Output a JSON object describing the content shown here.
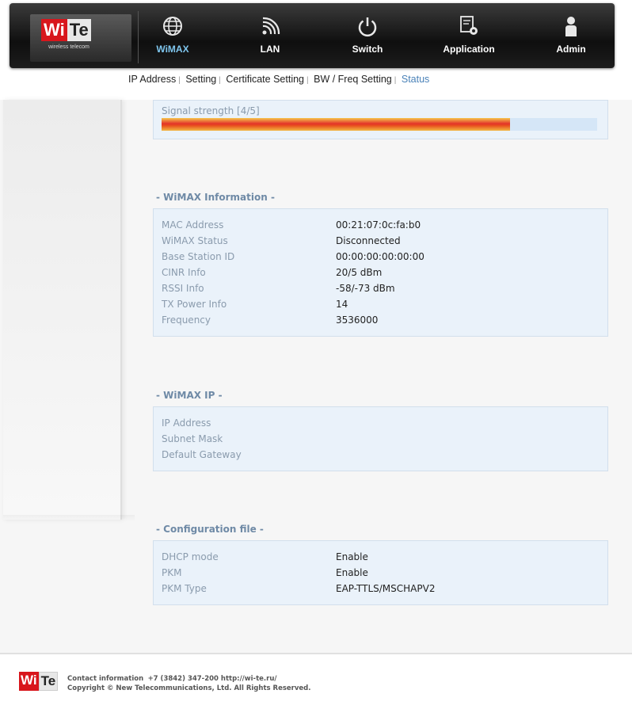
{
  "brand": {
    "logo_wi": "Wi",
    "logo_te": "Te",
    "logo_sub": "wireless telecom"
  },
  "nav": [
    {
      "label": "WiMAX",
      "icon": "globe-icon",
      "active": true
    },
    {
      "label": "LAN",
      "icon": "wireless-signal-icon",
      "active": false
    },
    {
      "label": "Switch",
      "icon": "power-icon",
      "active": false
    },
    {
      "label": "Application",
      "icon": "application-gear-icon",
      "active": false
    },
    {
      "label": "Admin",
      "icon": "user-icon",
      "active": false
    }
  ],
  "subnav": [
    {
      "label": "IP Address",
      "active": false
    },
    {
      "label": "Setting",
      "active": false
    },
    {
      "label": "Certificate Setting",
      "active": false
    },
    {
      "label": "BW / Freq Setting",
      "active": false
    },
    {
      "label": "Status",
      "active": true
    }
  ],
  "signal": {
    "label": "Signal strength [4/5]",
    "level": 0.8
  },
  "wimax_info": {
    "title": "- WiMAX Information -",
    "rows": [
      {
        "key": "MAC Address",
        "value": "00:21:07:0c:fa:b0"
      },
      {
        "key": "WiMAX Status",
        "value": "Disconnected"
      },
      {
        "key": "Base Station ID",
        "value": "00:00:00:00:00:00"
      },
      {
        "key": "CINR Info",
        "value": "20/5 dBm"
      },
      {
        "key": "RSSI Info",
        "value": "-58/-73 dBm"
      },
      {
        "key": "TX Power Info",
        "value": "14"
      },
      {
        "key": "Frequency",
        "value": "3536000"
      }
    ]
  },
  "wimax_ip": {
    "title": "- WiMAX IP -",
    "rows": [
      {
        "key": "IP Address",
        "value": ""
      },
      {
        "key": "Subnet Mask",
        "value": ""
      },
      {
        "key": "Default Gateway",
        "value": ""
      }
    ]
  },
  "config": {
    "title": "- Configuration file -",
    "rows": [
      {
        "key": "DHCP mode",
        "value": "Enable"
      },
      {
        "key": "PKM",
        "value": "Enable"
      },
      {
        "key": "PKM Type",
        "value": "EAP-TTLS/MSCHAPV2"
      }
    ]
  },
  "footer": {
    "contact_label": "Contact information",
    "contact_value": "+7 (3842) 347-200  http://wi-te.ru/",
    "copyright": "Copyright © New Telecommunications, Ltd.  All Rights Reserved."
  },
  "colors": {
    "accent": "#7fc6ee",
    "active_subnav": "#4a82b8",
    "panel_bg": "#eaf2fa",
    "brand_red": "#d8161c"
  }
}
